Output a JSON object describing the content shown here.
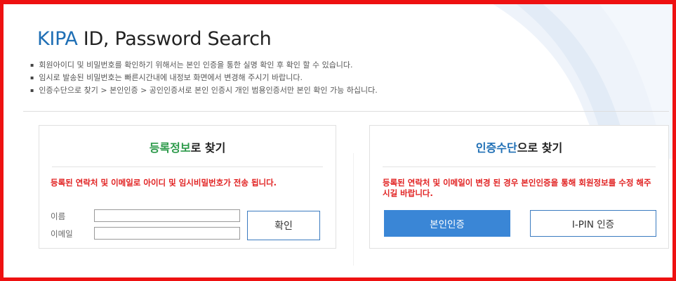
{
  "header": {
    "brand": "KIPA",
    "title_rest": " ID, Password Search"
  },
  "notes": [
    "회원아이디 및 비밀번호를 확인하기 위해서는 본인 인증을 통한 실명 확인 후 확인 할 수 있습니다.",
    "임시로 발송된 비밀번호는 빠른시간내에 내정보 화면에서 변경해 주시기 바랍니다.",
    "인증수단으로 찾기 > 본인인증 > 공인인증서로 본인 인증시 개인 범용인증서만 본인 확인 가능 하십니다."
  ],
  "left_panel": {
    "title_accent": "등록정보",
    "title_rest": "로 찾기",
    "warning": "등록된 연락처 및 이메일로 아이디 및 임시비밀번호가 전송 됩니다.",
    "name_label": "이름",
    "email_label": "이메일",
    "name_value": "",
    "email_value": "",
    "confirm_label": "확인"
  },
  "right_panel": {
    "title_accent": "인증수단",
    "title_rest": "으로 찾기",
    "warning": "등록된 연락처 및 이메일이 변경 된 경우 본인인증을 통해 회원정보를 수정 해주시길 바랍니다.",
    "self_auth_label": "본인인증",
    "ipin_label": "I-PIN 인증"
  },
  "colors": {
    "frame_border": "#ee1111",
    "brand_blue": "#1f6fb5",
    "accent_green": "#2c9a4a",
    "warning_red": "#e12222",
    "primary_button": "#3a86d6"
  }
}
